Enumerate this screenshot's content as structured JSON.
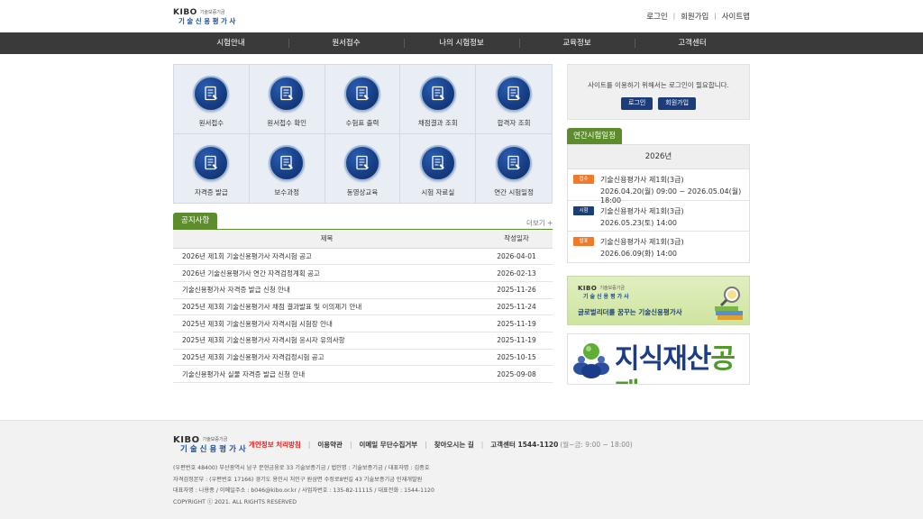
{
  "header": {
    "logo": {
      "brand": "KIBO",
      "sub": "기술보증기금",
      "name": "기술신용평가사"
    },
    "links": [
      "로그인",
      "회원가입",
      "사이트맵"
    ]
  },
  "nav": [
    "시험안내",
    "원서접수",
    "나의 시험정보",
    "교육정보",
    "고객센터"
  ],
  "quick_menu": [
    {
      "label": "원서접수",
      "icon": "application-form-icon"
    },
    {
      "label": "원서접수 확인",
      "icon": "application-check-icon"
    },
    {
      "label": "수험표 출력",
      "icon": "admission-ticket-print-icon"
    },
    {
      "label": "채점결과 조회",
      "icon": "score-result-icon"
    },
    {
      "label": "합격자 조회",
      "icon": "pass-list-icon"
    },
    {
      "label": "자격증 발급",
      "icon": "certificate-issue-icon"
    },
    {
      "label": "보수과정",
      "icon": "refresher-course-icon"
    },
    {
      "label": "동영상교육",
      "icon": "video-education-icon"
    },
    {
      "label": "시험 자료실",
      "icon": "exam-archive-icon"
    },
    {
      "label": "연간 시험일정",
      "icon": "annual-schedule-icon"
    }
  ],
  "notice": {
    "tab": "공지사항",
    "more": "더보기 +",
    "columns": [
      "제목",
      "작성일자"
    ],
    "rows": [
      {
        "title": "2026년 제1회 기술신용평가사 자격시험 공고",
        "date": "2026-04-01"
      },
      {
        "title": "2026년 기술신용평가사 연간 자격검정계획 공고",
        "date": "2026-02-13"
      },
      {
        "title": "기술신용평가사 자격증 발급 신청 안내",
        "date": "2025-11-26"
      },
      {
        "title": "2025년 제3회 기술신용평가사 채점 결과발표 및 이의제기 안내",
        "date": "2025-11-24"
      },
      {
        "title": "2025년 제3회 기술신용평가사 자격시험 시험장 안내",
        "date": "2025-11-19"
      },
      {
        "title": "2025년 제3회 기술신용평가사 자격시험 응시자 유의사항",
        "date": "2025-11-19"
      },
      {
        "title": "2025년 제3회 기술신용평가사 자격검정시험 공고",
        "date": "2025-10-15"
      },
      {
        "title": "기술신용평가사 실물 자격증 발급 신청 안내",
        "date": "2025-09-08"
      }
    ]
  },
  "login": {
    "message": "사이트를 이용하기 위해서는 로그인이 필요합니다.",
    "login_label": "로그인",
    "join_label": "회원가입"
  },
  "schedule": {
    "tab": "연간시험일정",
    "year": "2026년",
    "items": [
      {
        "badge": "접수",
        "color": "#f07a2a",
        "name": "기술신용평가사 제1회(3급)",
        "date": "2026.04.20(월) 09:00 ~ 2026.05.04(월) 18:00"
      },
      {
        "badge": "시험",
        "color": "#1c3d7a",
        "name": "기술신용평가사 제1회(3급)",
        "date": "2026.05.23(토) 14:00"
      },
      {
        "badge": "발표",
        "color": "#f07a2a",
        "name": "기술신용평가사 제1회(3급)",
        "date": "2026.06.09(화) 14:00"
      }
    ]
  },
  "banners": {
    "global": {
      "brand": "KIBO",
      "sub": "기술보증기금",
      "name": "기술신용평가사",
      "text": "글로벌리더를 꿈꾸는 기술신용평가사"
    },
    "ip": {
      "text_main": "지식재산",
      "text_accent": "공제"
    }
  },
  "footer": {
    "logo": {
      "brand": "KIBO",
      "sub": "기술보증기금",
      "name": "기술신용평가사"
    },
    "privacy": "개인정보 처리방침",
    "terms": "이용약관",
    "no_email": "이메일 무단수집거부",
    "directions": "찾아오시는 길",
    "contact": "고객센터 1544-1120",
    "contact_time": "(월~금: 9:00 ~ 18:00)",
    "info": [
      "(우편번호 48400) 부산광역시 남구 문현금융로 33 기술보증기금 / 법인명 : 기술보증기금 / 대표자명 : 김종호",
      "자격검정본부 : (우편번호 17166) 경기도 용인시 처인구 원삼면 수정로8번길 43 기술보증기금 인재개발원",
      "대표자명 : 나용종 / 이메일주소 : b046@kibo.or.kr / 사업자번호 : 135-82-11115 / 대표전화 : 1544-1120",
      "COPYRIGHT ⓒ 2021. ALL RIGHTS RESERVED"
    ]
  }
}
